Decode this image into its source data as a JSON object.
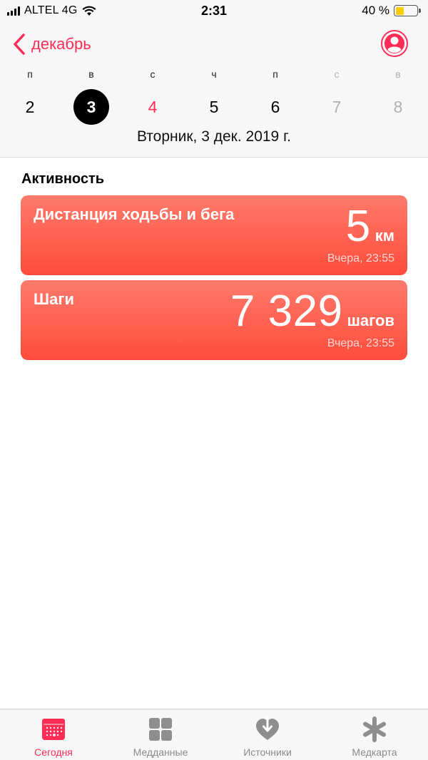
{
  "status": {
    "carrier": "ALTEL 4G",
    "time": "2:31",
    "battery": "40 %",
    "battery_level": 0.4
  },
  "nav": {
    "back_label": "декабрь"
  },
  "week": {
    "weekdays": [
      "п",
      "в",
      "с",
      "ч",
      "п",
      "с",
      "в"
    ],
    "days": [
      "2",
      "3",
      "4",
      "5",
      "6",
      "7",
      "8"
    ],
    "selected_index": 1,
    "today_index": 2,
    "full_date": "Вторник, 3 дек. 2019 г."
  },
  "section": {
    "title": "Активность"
  },
  "cards": [
    {
      "title": "Дистанция ходьбы и бега",
      "value": "5",
      "unit": "км",
      "time": "Вчера, 23:55"
    },
    {
      "title": "Шаги",
      "value": "7 329",
      "unit": "шагов",
      "time": "Вчера, 23:55"
    }
  ],
  "tabs": [
    {
      "label": "Сегодня",
      "icon": "calendar-icon",
      "active": true
    },
    {
      "label": "Медданные",
      "icon": "grid-icon",
      "active": false
    },
    {
      "label": "Источники",
      "icon": "heart-download-icon",
      "active": false
    },
    {
      "label": "Медкарта",
      "icon": "asterisk-icon",
      "active": false
    }
  ],
  "colors": {
    "accent": "#ff2d55",
    "card_top": "#ff7a6b",
    "card_bottom": "#ff4c3c"
  }
}
